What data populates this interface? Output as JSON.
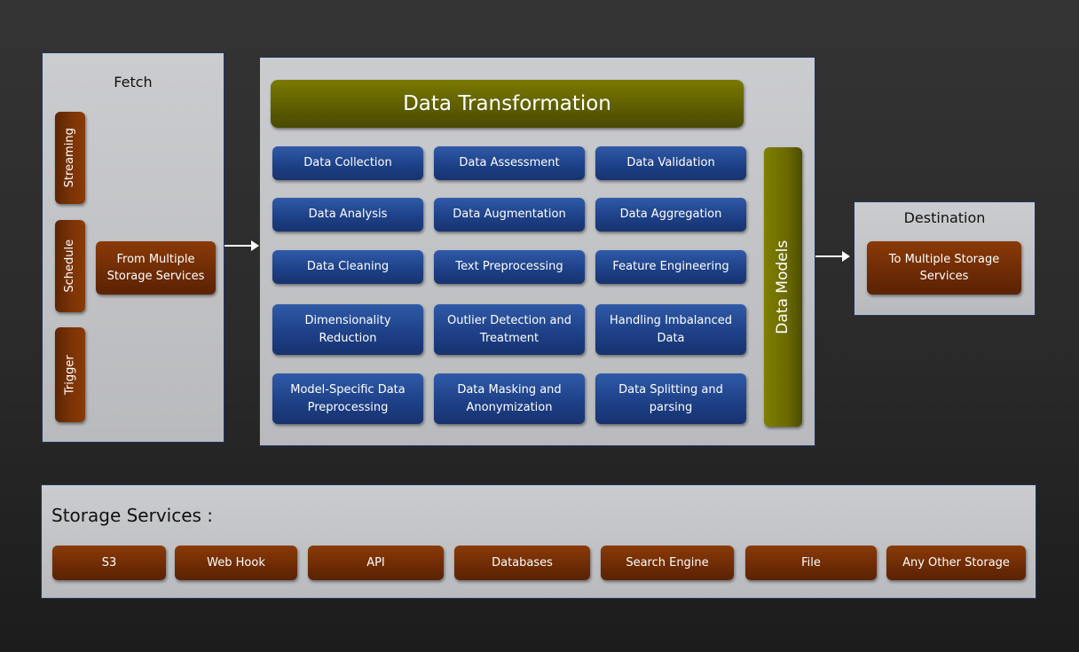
{
  "fetch": {
    "title": "Fetch",
    "modes": [
      "Streaming",
      "Schedule",
      "Trigger"
    ],
    "source": "From Multiple Storage Services"
  },
  "transformation": {
    "title": "Data Transformation",
    "steps": [
      "Data Collection",
      "Data Assessment",
      "Data Validation",
      "Data Analysis",
      "Data Augmentation",
      "Data Aggregation",
      "Data Cleaning",
      "Text Preprocessing",
      "Feature Engineering",
      "Dimensionality Reduction",
      "Outlier Detection and Treatment",
      "Handling Imbalanced Data",
      "Model-Specific Data Preprocessing",
      "Data Masking and Anonymization",
      "Data Splitting and parsing"
    ],
    "models": "Data Models"
  },
  "destination": {
    "title": "Destination",
    "target": "To Multiple Storage Services"
  },
  "storage": {
    "title": "Storage Services :",
    "items": [
      "S3",
      "Web Hook",
      "API",
      "Databases",
      "Search Engine",
      "File",
      "Any Other Storage"
    ]
  },
  "colors": {
    "panel_border": "#1f3563",
    "blue": "#1d3f85",
    "brown": "#6d2b05",
    "olive": "#5c5c00"
  }
}
